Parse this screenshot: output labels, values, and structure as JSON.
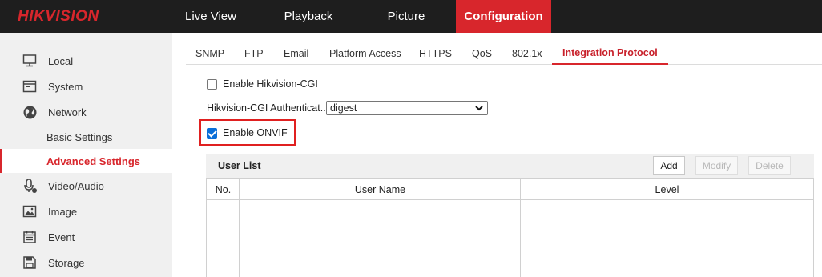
{
  "brand": {
    "logo_text": "HIKVISION",
    "accent_color": "#d8262c"
  },
  "top_nav": {
    "items": [
      {
        "label": "Live View",
        "active": false
      },
      {
        "label": "Playback",
        "active": false
      },
      {
        "label": "Picture",
        "active": false
      },
      {
        "label": "Configuration",
        "active": true
      }
    ]
  },
  "sidebar": {
    "items": [
      {
        "label": "Local",
        "icon": "monitor-icon"
      },
      {
        "label": "System",
        "icon": "system-window-icon"
      },
      {
        "label": "Network",
        "icon": "globe-icon"
      },
      {
        "label": "Basic Settings",
        "sub": true,
        "active": false
      },
      {
        "label": "Advanced Settings",
        "sub": true,
        "active": true
      },
      {
        "label": "Video/Audio",
        "icon": "microphone-icon"
      },
      {
        "label": "Image",
        "icon": "image-icon"
      },
      {
        "label": "Event",
        "icon": "calendar-icon"
      },
      {
        "label": "Storage",
        "icon": "floppy-disk-icon"
      }
    ]
  },
  "tabs": {
    "items": [
      {
        "label": "SNMP",
        "active": false
      },
      {
        "label": "FTP",
        "active": false
      },
      {
        "label": "Email",
        "active": false
      },
      {
        "label": "Platform Access",
        "active": false
      },
      {
        "label": "HTTPS",
        "active": false
      },
      {
        "label": "QoS",
        "active": false
      },
      {
        "label": "802.1x",
        "active": false
      },
      {
        "label": "Integration Protocol",
        "active": true
      }
    ]
  },
  "form": {
    "enable_hikvision_cgi": {
      "label": "Enable Hikvision-CGI",
      "checked": false
    },
    "cgi_auth": {
      "label": "Hikvision-CGI Authenticat...",
      "value": "digest"
    },
    "enable_onvif": {
      "label": "Enable ONVIF",
      "checked": true
    }
  },
  "user_list": {
    "title": "User List",
    "buttons": {
      "add": "Add",
      "modify": "Modify",
      "delete": "Delete"
    },
    "columns": [
      "No.",
      "User Name",
      "Level"
    ],
    "rows": []
  }
}
